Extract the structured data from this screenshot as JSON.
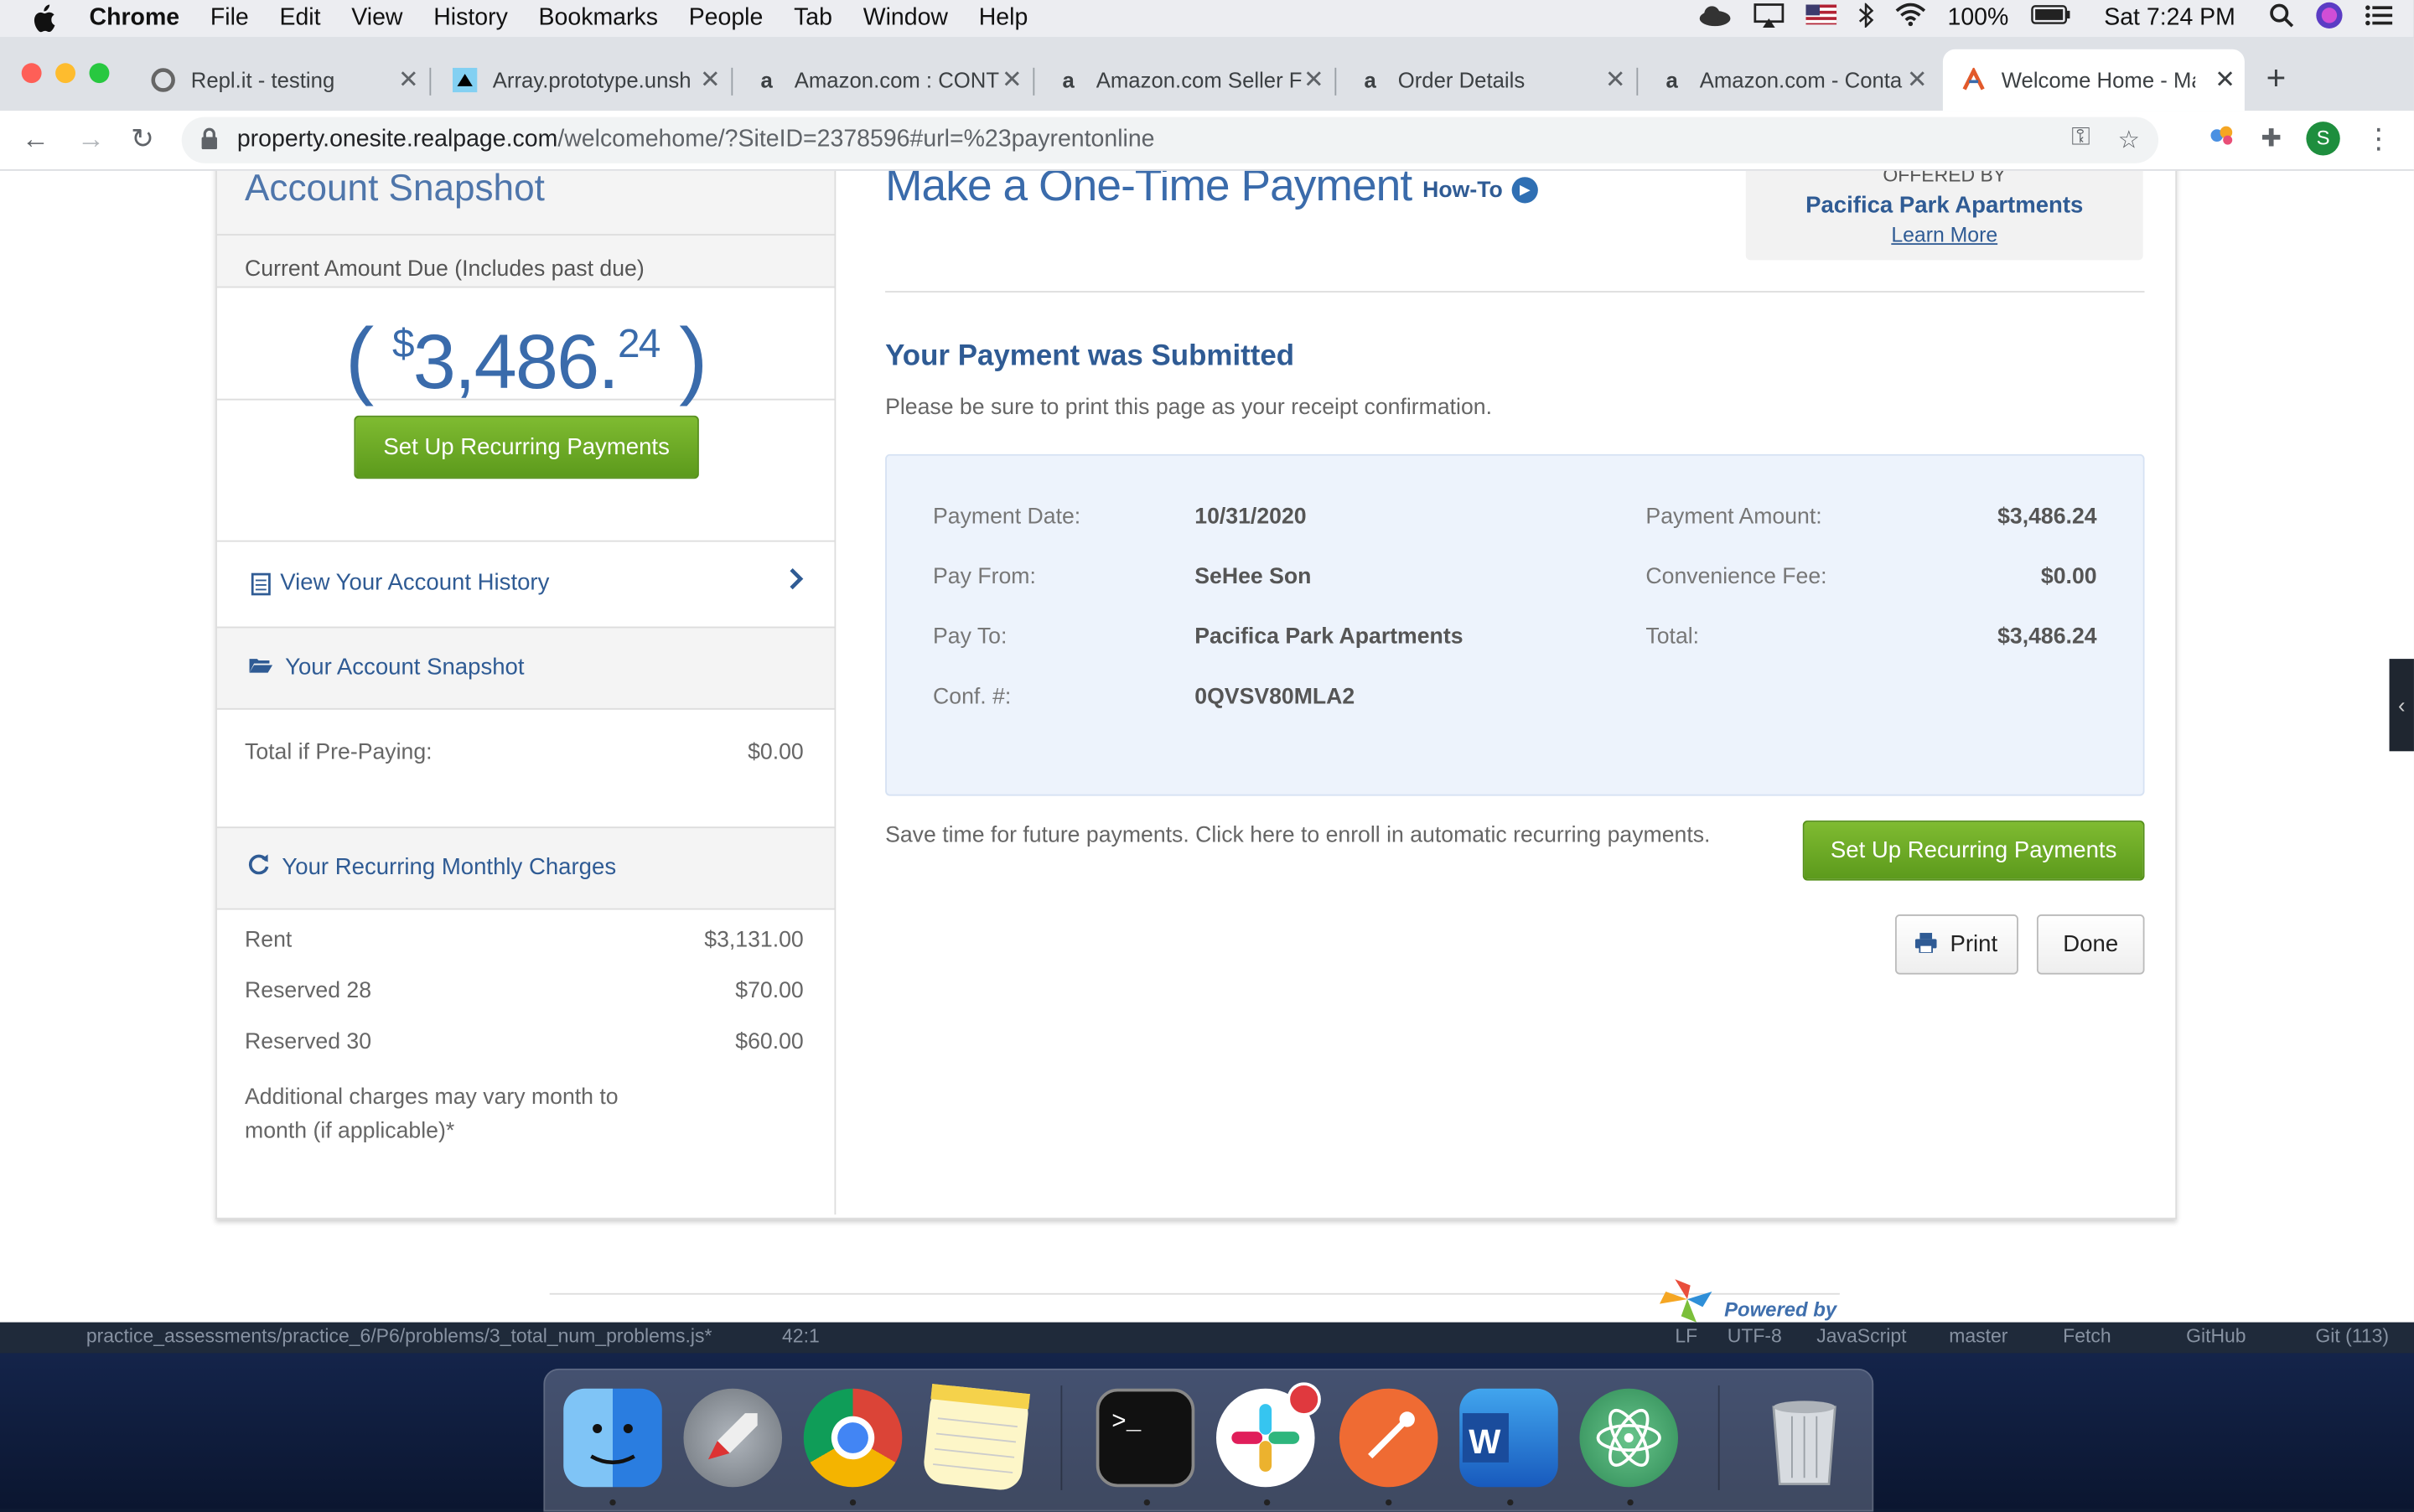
{
  "menubar": {
    "app": "Chrome",
    "items": [
      "File",
      "Edit",
      "View",
      "History",
      "Bookmarks",
      "People",
      "Tab",
      "Window",
      "Help"
    ],
    "battery": "100%",
    "clock": "Sat 7:24 PM"
  },
  "tabs": [
    {
      "title": "Repl.it - testing"
    },
    {
      "title": "Array.prototype.unsh"
    },
    {
      "title": "Amazon.com : CONT"
    },
    {
      "title": "Amazon.com Seller F"
    },
    {
      "title": "Order Details"
    },
    {
      "title": "Amazon.com - Conta"
    },
    {
      "title": "Welcome Home - Ma"
    }
  ],
  "address": {
    "host": "property.onesite.realpage.com",
    "path": "/welcomehome/?SiteID=2378596#url=%23payrentonline"
  },
  "profile_initial": "S",
  "sidebar": {
    "heading": "Account Snapshot",
    "amount_label": "Current Amount Due (Includes past due)",
    "amount": {
      "open": "(",
      "currency": "$",
      "dollars": "3,486.",
      "cents": "24",
      "close": ")"
    },
    "recurring_button": "Set Up Recurring Payments",
    "history_link": "View Your Account History",
    "snapshot_title": "Your Account Snapshot",
    "prepay_label": "Total if Pre-Paying:",
    "prepay_value": "$0.00",
    "recurring_title": "Your Recurring Monthly Charges",
    "charges": [
      {
        "label": "Rent",
        "value": "$3,131.00"
      },
      {
        "label": "Reserved 28",
        "value": "$70.00"
      },
      {
        "label": "Reserved 30",
        "value": "$60.00"
      }
    ],
    "charges_note": "Additional charges may vary month to month (if applicable)*"
  },
  "main": {
    "title": "Make a One-Time Payment",
    "howto": "How-To",
    "offered_by": "OFFERED BY",
    "property": "Pacifica Park Apartments",
    "learn_more": "Learn More",
    "submitted_title": "Your Payment was Submitted",
    "receipt_note": "Please be sure to print this page as your receipt confirmation.",
    "receipt": {
      "payment_date_label": "Payment Date:",
      "payment_date": "10/31/2020",
      "pay_from_label": "Pay From:",
      "pay_from": "SeHee Son",
      "pay_to_label": "Pay To:",
      "pay_to": "Pacifica Park Apartments",
      "conf_label": "Conf. #:",
      "conf": "0QVSV80MLA2",
      "amount_label": "Payment Amount:",
      "amount": "$3,486.24",
      "fee_label": "Convenience Fee:",
      "fee": "$0.00",
      "total_label": "Total:",
      "total": "$3,486.24"
    },
    "enroll_text": "Save time for future payments. Click here to enroll in automatic recurring payments.",
    "recurring_button": "Set Up Recurring Payments",
    "print_button": "Print",
    "done_button": "Done",
    "powered_by": "Powered by"
  },
  "editor_status": {
    "path": "practice_assessments/practice_6/P6/problems/3_total_num_problems.js*",
    "cursor": "42:1",
    "items": [
      "LF",
      "UTF-8",
      "JavaScript",
      "master",
      "Fetch",
      "GitHub",
      "Git (113)"
    ]
  },
  "colors": {
    "brand_blue": "#3a6bab",
    "link_blue": "#2f5b94",
    "button_green": "#6aa824",
    "receipt_bg": "#edf3fc"
  }
}
